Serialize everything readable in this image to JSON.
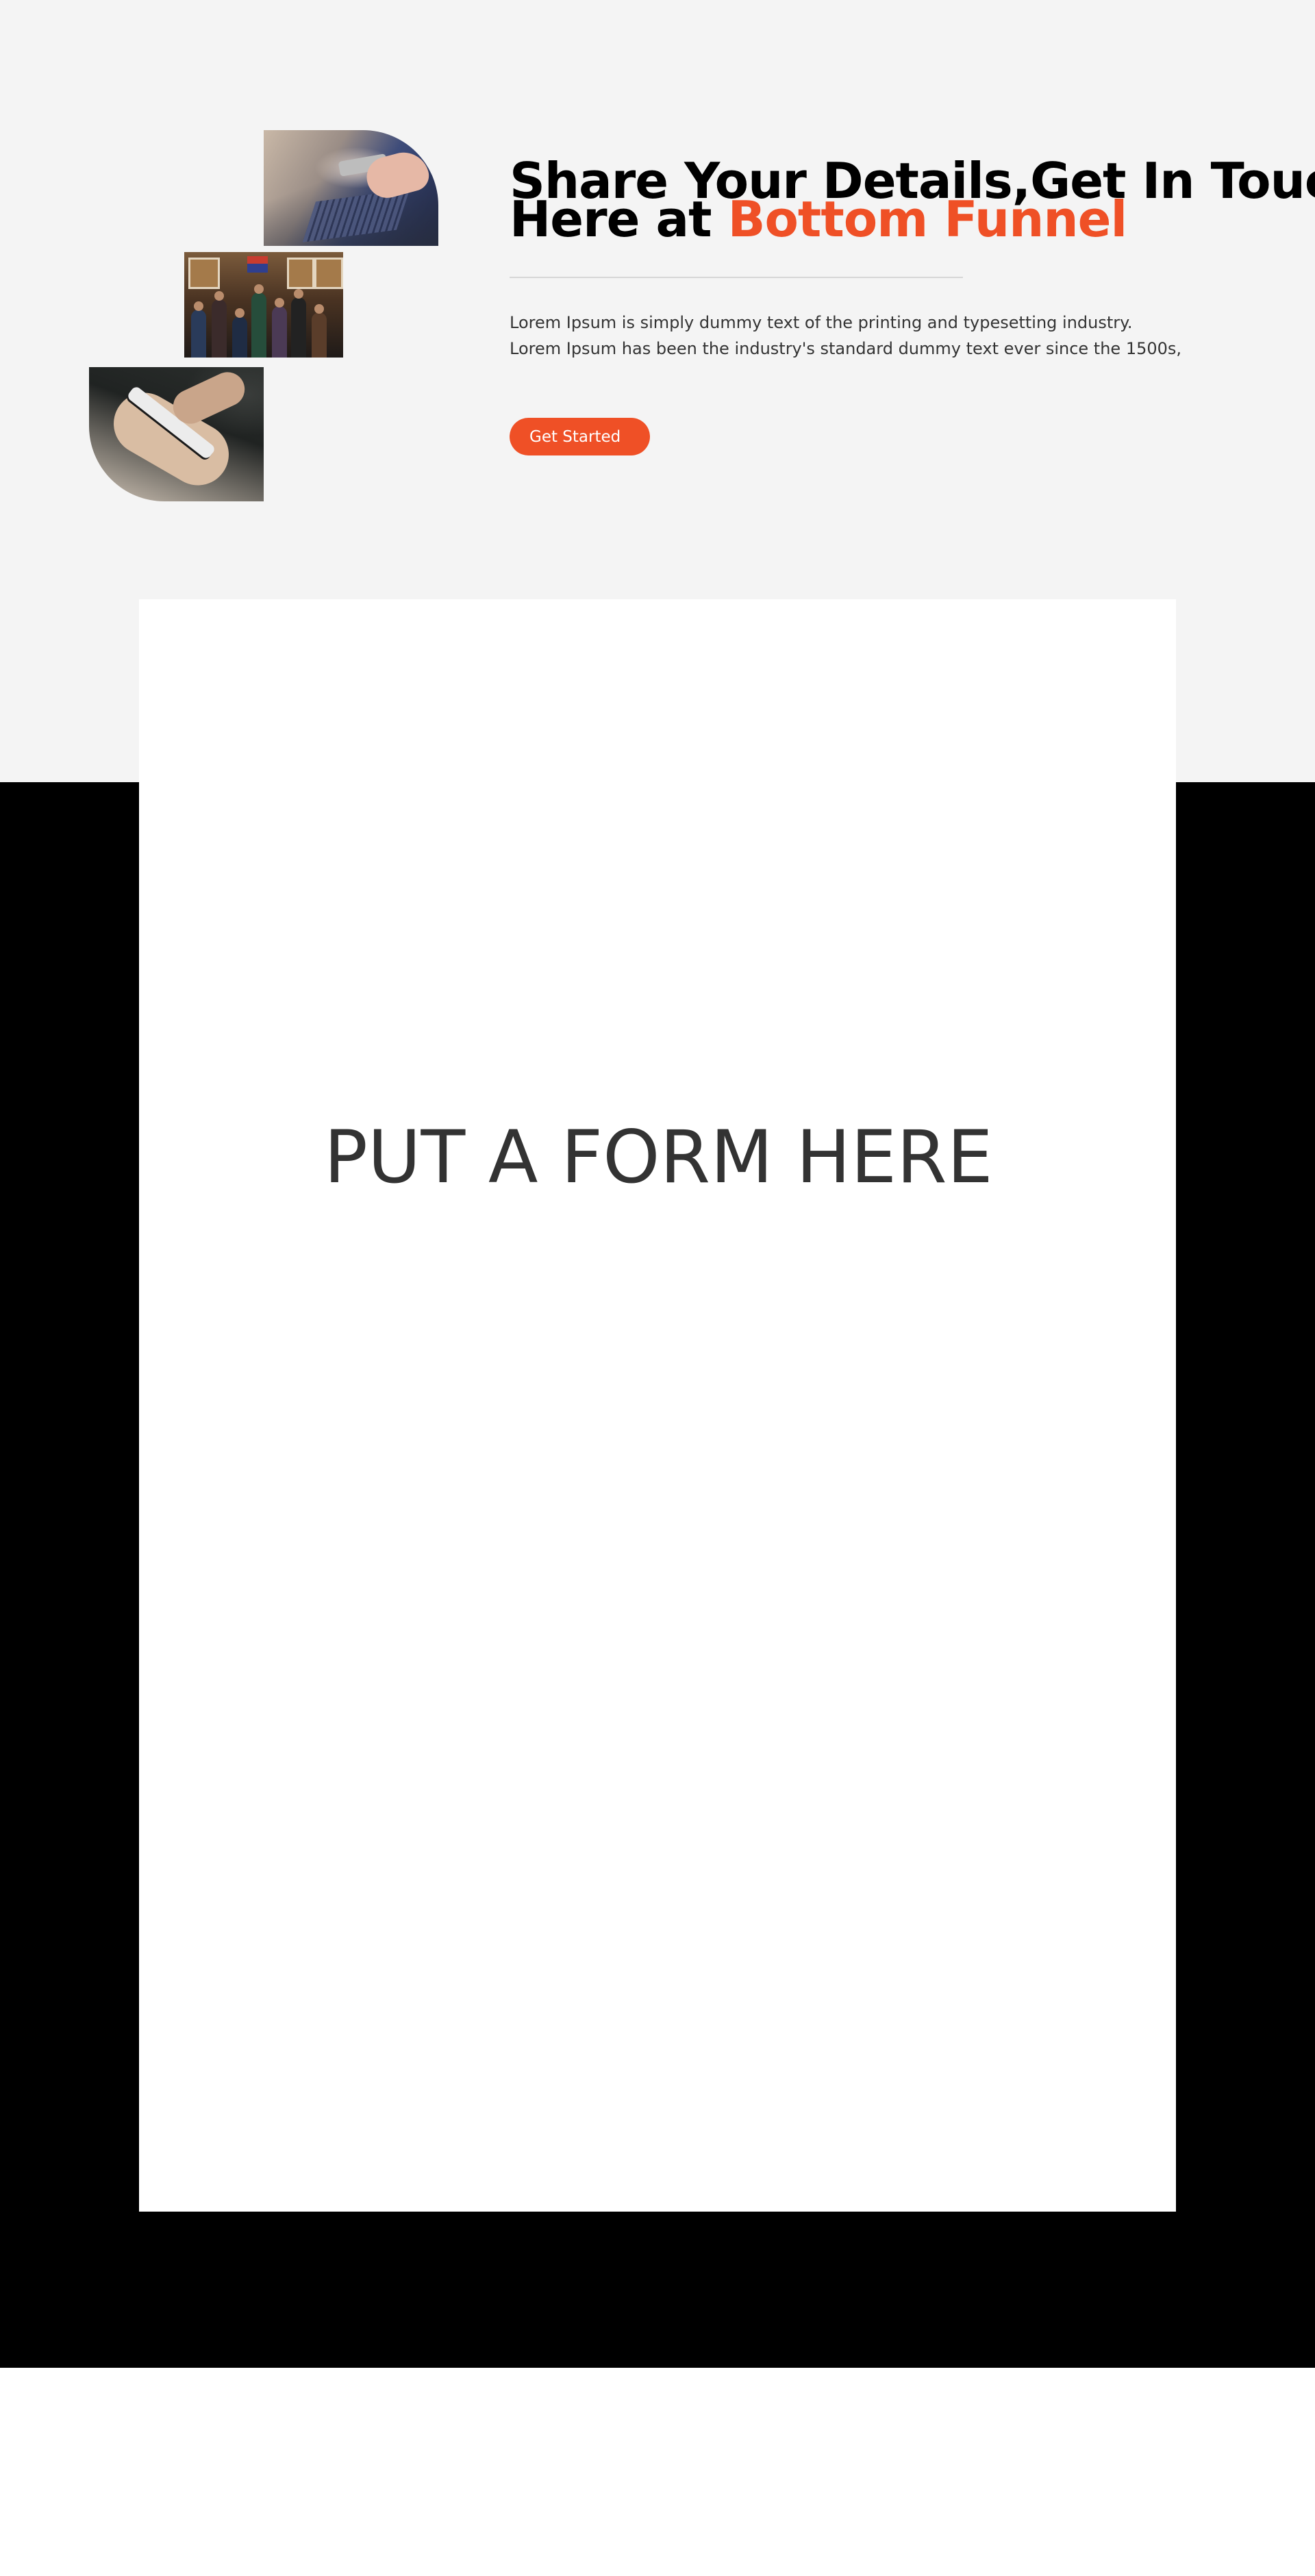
{
  "hero": {
    "headline_line1": "Share Your Details,Get In Touch",
    "headline_line2_prefix": "Here at ",
    "headline_accent": "Bottom Funnel",
    "body_line1": "Lorem Ipsum is simply dummy text of the printing and typesetting industry.",
    "body_line2": "Lorem Ipsum has been the industry's standard dummy text ever since the 1500s,",
    "cta_label": "Get Started"
  },
  "form_section": {
    "placeholder_text": "PUT A FORM HERE"
  },
  "colors": {
    "accent": "#ef5026",
    "hero_background": "#f4f4f4",
    "band_background": "#000000",
    "card_background": "#ffffff",
    "headline": "#000000",
    "body_text": "#333333"
  }
}
